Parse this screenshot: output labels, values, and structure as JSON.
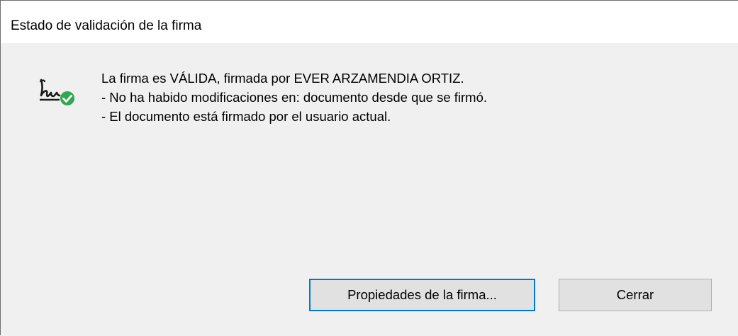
{
  "window": {
    "title": "Estado de validación de la firma"
  },
  "status": {
    "icon": "signature-valid-icon",
    "lines": [
      "La firma es VÁLIDA, firmada por EVER ARZAMENDIA ORTIZ.",
      "- No ha habido modificaciones en: documento desde que se firmó.",
      "- El documento está firmado por el usuario actual."
    ]
  },
  "buttons": {
    "properties_label": "Propiedades de la firma...",
    "close_label": "Cerrar"
  },
  "colors": {
    "accent": "#0078d7",
    "valid": "#2fa84f",
    "panel": "#f0f0f0",
    "button": "#e1e1e1"
  }
}
